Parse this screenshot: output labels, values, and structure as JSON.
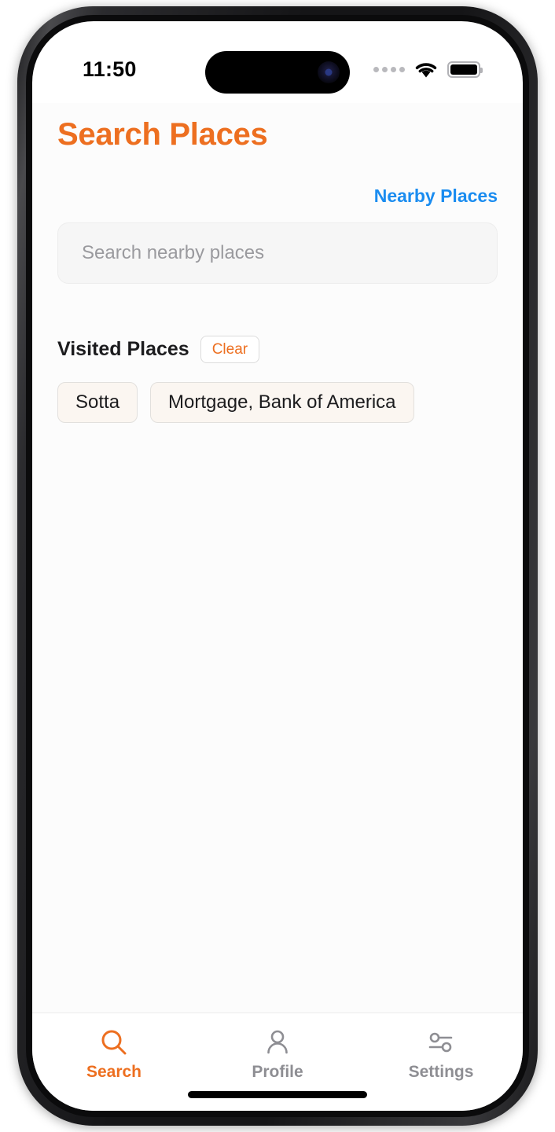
{
  "status_bar": {
    "time": "11:50",
    "cellular_icon": "cellular-dots-icon",
    "wifi_icon": "wifi-icon",
    "battery_icon": "battery-full-icon"
  },
  "header": {
    "title": "Search Places",
    "title_color": "#ed6f20"
  },
  "nearby": {
    "label": "Nearby Places",
    "color": "#1a8cf0"
  },
  "search": {
    "placeholder": "Search nearby places",
    "value": ""
  },
  "visited": {
    "title": "Visited Places",
    "clear_label": "Clear",
    "clear_color": "#ed6f20",
    "chips": [
      {
        "label": "Sotta"
      },
      {
        "label": "Mortgage, Bank of America"
      }
    ]
  },
  "tabbar": {
    "items": [
      {
        "label": "Search",
        "icon": "search-icon",
        "active": true
      },
      {
        "label": "Profile",
        "icon": "person-icon",
        "active": false
      },
      {
        "label": "Settings",
        "icon": "sliders-icon",
        "active": false
      }
    ],
    "active_color": "#ed6f20",
    "inactive_color": "#8e8e93"
  }
}
